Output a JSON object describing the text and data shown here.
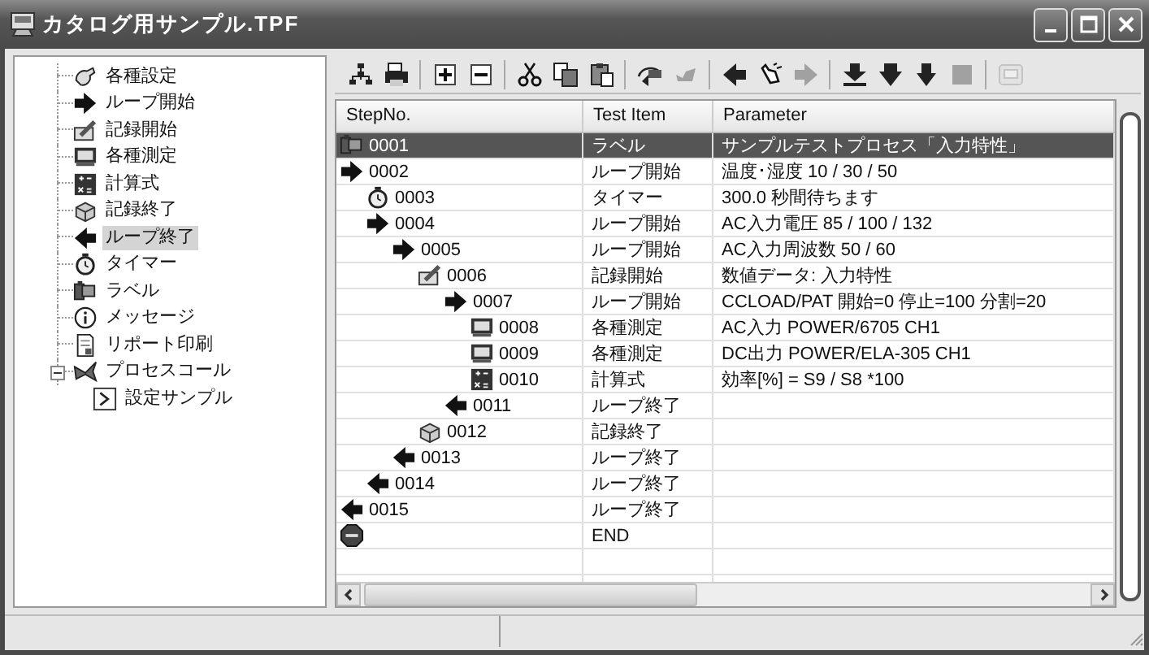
{
  "window": {
    "title": "カタログ用サンプル.TPF"
  },
  "tree": {
    "items": [
      {
        "label": "各種設定",
        "kind": "settings",
        "selected": false
      },
      {
        "label": "ループ開始",
        "kind": "loop-start",
        "selected": false
      },
      {
        "label": "記録開始",
        "kind": "record-start",
        "selected": false
      },
      {
        "label": "各種測定",
        "kind": "measure",
        "selected": false
      },
      {
        "label": "計算式",
        "kind": "calc",
        "selected": false
      },
      {
        "label": "記録終了",
        "kind": "record-end",
        "selected": false
      },
      {
        "label": "ループ終了",
        "kind": "loop-end",
        "selected": true
      },
      {
        "label": "タイマー",
        "kind": "timer",
        "selected": false
      },
      {
        "label": "ラベル",
        "kind": "label",
        "selected": false
      },
      {
        "label": "メッセージ",
        "kind": "message",
        "selected": false
      },
      {
        "label": "リポート印刷",
        "kind": "report",
        "selected": false
      },
      {
        "label": "プロセスコール",
        "kind": "process",
        "selected": false,
        "expanded": true,
        "children": [
          {
            "label": "設定サンプル",
            "kind": "sample",
            "selected": false
          }
        ]
      }
    ]
  },
  "toolbar": [
    [
      {
        "kind": "network",
        "disabled": false
      },
      {
        "kind": "printer",
        "disabled": false
      }
    ],
    [
      {
        "kind": "plus",
        "disabled": false
      },
      {
        "kind": "minus",
        "disabled": false
      }
    ],
    [
      {
        "kind": "cut",
        "disabled": false
      },
      {
        "kind": "copy",
        "disabled": false
      },
      {
        "kind": "paste",
        "disabled": false
      }
    ],
    [
      {
        "kind": "skip",
        "disabled": false
      },
      {
        "kind": "unskip",
        "disabled": true
      }
    ],
    [
      {
        "kind": "left",
        "disabled": false
      },
      {
        "kind": "hand",
        "disabled": false
      },
      {
        "kind": "right",
        "disabled": true
      }
    ],
    [
      {
        "kind": "down-bar",
        "disabled": false
      },
      {
        "kind": "down",
        "disabled": false
      },
      {
        "kind": "down-small",
        "disabled": false
      },
      {
        "kind": "stop",
        "disabled": true
      }
    ],
    [
      {
        "kind": "screen",
        "disabled": true
      }
    ]
  ],
  "table": {
    "columns": [
      "StepNo.",
      "Test Item",
      "Parameter"
    ],
    "rows": [
      {
        "step": "0001",
        "kind": "label",
        "item": "ラベル",
        "parameter": "サンプルテストプロセス「入力特性」",
        "selected": true
      },
      {
        "step": "0002",
        "kind": "loop-start",
        "item": "ループ開始",
        "parameter": "温度･湿度 10 / 30 / 50",
        "selected": false,
        "children": [
          {
            "step": "0003",
            "kind": "timer",
            "item": "タイマー",
            "parameter": "300.0 秒間待ちます",
            "selected": false
          },
          {
            "step": "0004",
            "kind": "loop-start",
            "item": "ループ開始",
            "parameter": "AC入力電圧 85 / 100 / 132",
            "selected": false,
            "children": [
              {
                "step": "0005",
                "kind": "loop-start",
                "item": "ループ開始",
                "parameter": "AC入力周波数 50 / 60",
                "selected": false,
                "children": [
                  {
                    "step": "0006",
                    "kind": "record-start",
                    "item": "記録開始",
                    "parameter": "数値データ: 入力特性",
                    "selected": false,
                    "children": [
                      {
                        "step": "0007",
                        "kind": "loop-start",
                        "item": "ループ開始",
                        "parameter": " CCLOAD/PAT 開始=0 停止=100 分割=20",
                        "selected": false,
                        "children": [
                          {
                            "step": "0008",
                            "kind": "measure",
                            "item": "各種測定",
                            "parameter": "AC入力 POWER/6705 CH1",
                            "selected": false
                          },
                          {
                            "step": "0009",
                            "kind": "measure",
                            "item": "各種測定",
                            "parameter": "DC出力 POWER/ELA-305 CH1",
                            "selected": false
                          },
                          {
                            "step": "0010",
                            "kind": "calc",
                            "item": "計算式",
                            "parameter": "効率[%] = S9 / S8 *100",
                            "selected": false
                          }
                        ]
                      },
                      {
                        "step": "0011",
                        "kind": "loop-end",
                        "item": "ループ終了",
                        "selected": false
                      }
                    ]
                  },
                  {
                    "step": "0012",
                    "kind": "record-end",
                    "item": "記録終了",
                    "selected": false
                  }
                ]
              },
              {
                "step": "0013",
                "kind": "loop-end",
                "item": "ループ終了",
                "selected": false
              }
            ]
          },
          {
            "step": "0014",
            "kind": "loop-end",
            "item": "ループ終了",
            "selected": false
          }
        ]
      },
      {
        "step": "0015",
        "kind": "loop-end",
        "item": "ループ終了",
        "selected": false
      },
      {
        "kind": "end",
        "item": "END",
        "selected": false
      }
    ]
  }
}
